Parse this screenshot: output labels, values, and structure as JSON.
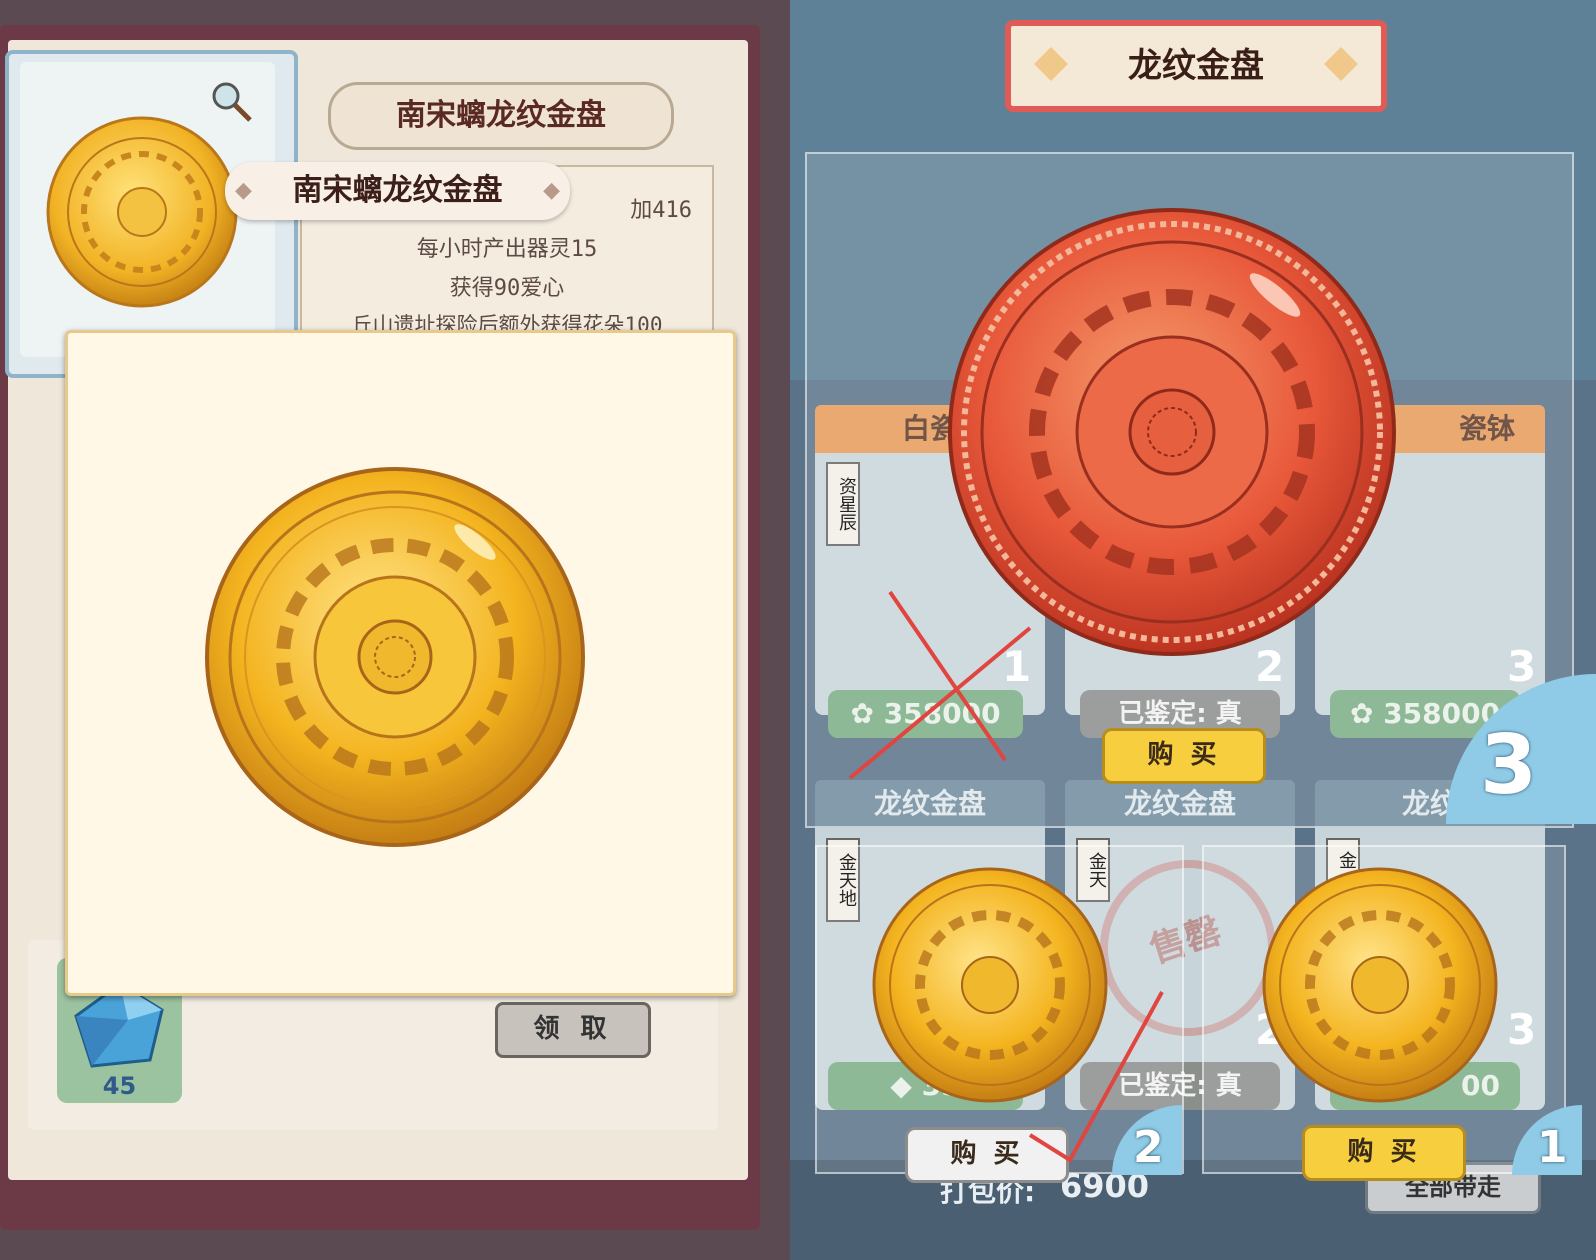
{
  "left": {
    "title": "南宋螭龙纹金盘",
    "tag_title": "南宋螭龙纹金盘",
    "info_lines": [
      "加416",
      "每小时产出器灵15",
      "获得90爱心",
      "丘山遗址探险后额外获得花朵100"
    ],
    "reward_count": "45",
    "claim_label": "领 取"
  },
  "right": {
    "header_title": "龙纹金盘",
    "cards_top": [
      {
        "title": "白瓷",
        "seal": "资星辰",
        "price": "358000",
        "slot": "1"
      },
      {
        "title": "",
        "status": "已鉴定: 真",
        "slot": "2"
      },
      {
        "title": "瓷钵",
        "price": "358000",
        "slot": "3"
      }
    ],
    "cards_bottom": [
      {
        "title": "龙纹金盘",
        "seal": "金天地",
        "price": "35",
        "slot": "1"
      },
      {
        "title": "龙纹金盘",
        "seal": "金天",
        "status": "已鉴定: 真",
        "stamp": "售罄",
        "slot": "2"
      },
      {
        "title": "龙纹",
        "seal": "金",
        "price": "00",
        "slot": "3"
      }
    ],
    "buy_label": "购 买",
    "bundle_label": "打包价:",
    "bundle_price": "6900",
    "take_all_label": "全部带走",
    "rank_badges": [
      "3",
      "2",
      "1"
    ]
  },
  "colors": {
    "gold": "#f4b41f",
    "red_plate": "#e8583a",
    "header_border": "#e05b55",
    "buy_yellow": "#f7cf3e"
  }
}
